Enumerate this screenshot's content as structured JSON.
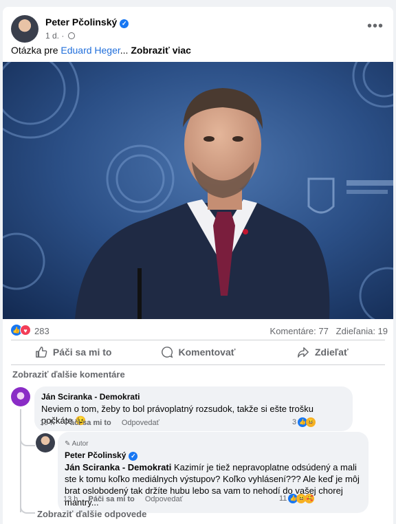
{
  "post": {
    "author": "Peter Pčolinský",
    "time": "1 d.",
    "more": "•••",
    "text_prefix": "Otázka pre ",
    "mention": "Eduard Heger",
    "ellipsis": "... ",
    "see_more": "Zobraziť viac"
  },
  "reactions": {
    "count": "283",
    "comments": "Komentáre: 77",
    "shares": "Zdieľania: 19"
  },
  "actions": {
    "like": "Páči sa mi to",
    "comment": "Komentovať",
    "share": "Zdieľať"
  },
  "comments_section": {
    "show_more": "Zobraziť ďalšie komentáre",
    "show_more_replies": "Zobraziť ďalšie odpovede"
  },
  "comment1": {
    "author": "Ján Sciranka - Demokrati",
    "text": "Neviem o tom, žeby to bol právoplatný rozsudok, takže si ešte trošku počkáte",
    "emoji": "😉",
    "time": "19 h",
    "like": "Páči sa mi to",
    "reply": "Odpovedať",
    "reaction_count": "3"
  },
  "comment2": {
    "badge": "Autor",
    "author": "Peter Pčolinský",
    "tag": "Ján Sciranka - Demokrati",
    "text": " Kazimír je tiež nepravoplatne odsúdený a mali ste k tomu koľko mediálnych výstupov? Koľko vyhlásení??? Ale keď je môj brat oslobodený tak držíte hubu lebo sa vam to nehodí do vašej chorej mantry...",
    "time": "13 h",
    "like": "Páči sa mi to",
    "reply": "Odpovedať",
    "reaction_count": "11"
  },
  "colors": {
    "link": "#216fdb",
    "facebook_blue": "#1877f2",
    "love": "#f33e58",
    "bubble": "#f0f2f5"
  }
}
